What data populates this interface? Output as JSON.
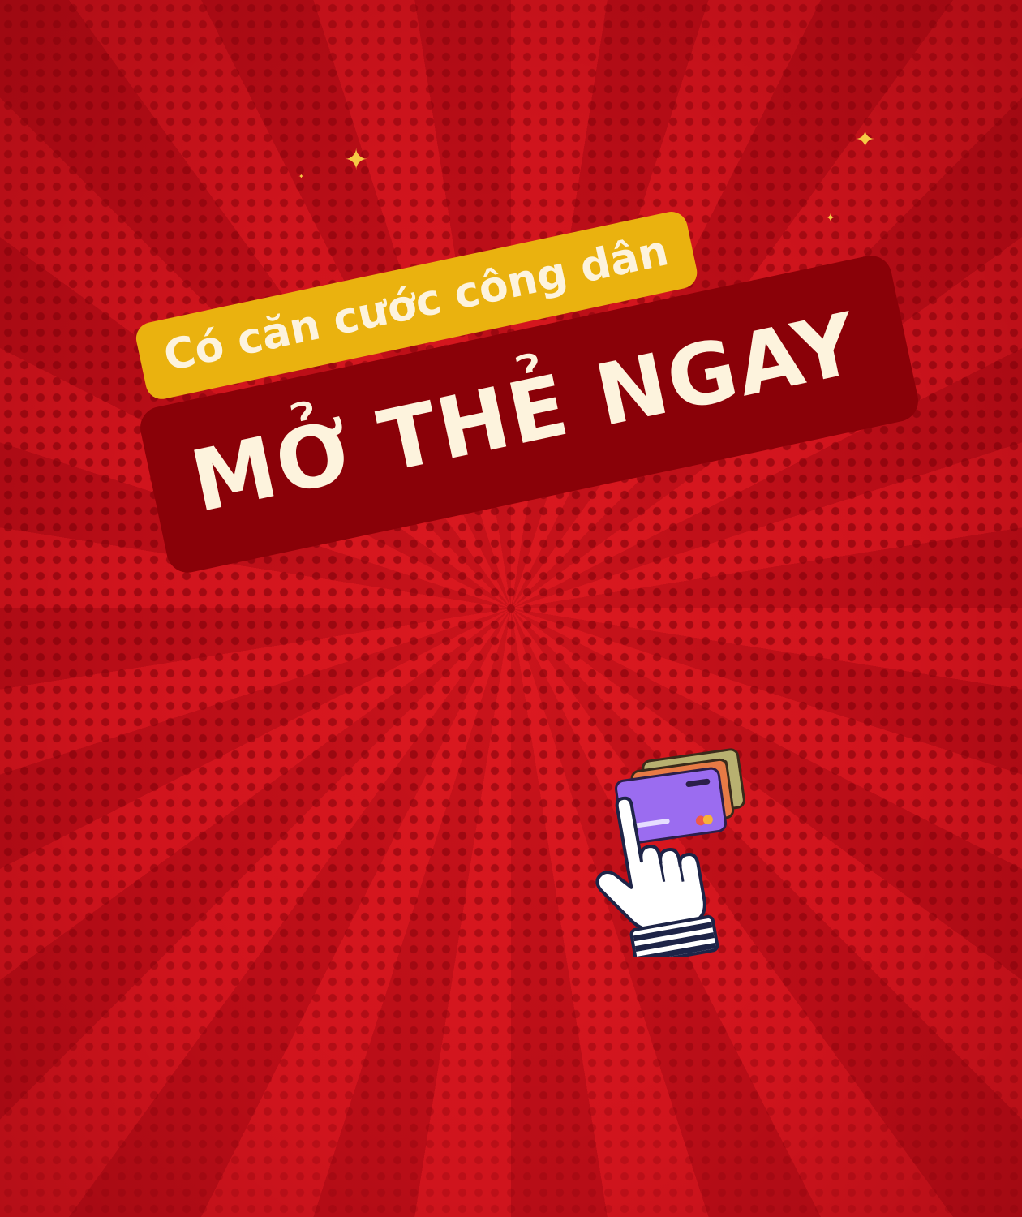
{
  "headline": {
    "line1": "Có căn cước công dân",
    "line2": "MỞ THẺ NGAY"
  },
  "colors": {
    "background_red": "#c8101a",
    "ray_dark": "#b80d17",
    "halftone_dot": "#78000a",
    "pill_yellow": "#eab20f",
    "pill_dark_red": "#8a0108",
    "text_cream": "#fdf3dd",
    "sparkle_gold": "#f6c945"
  },
  "icons": {
    "sparkles": "four-point-star",
    "illustration": "hand-tapping-credit-cards"
  }
}
